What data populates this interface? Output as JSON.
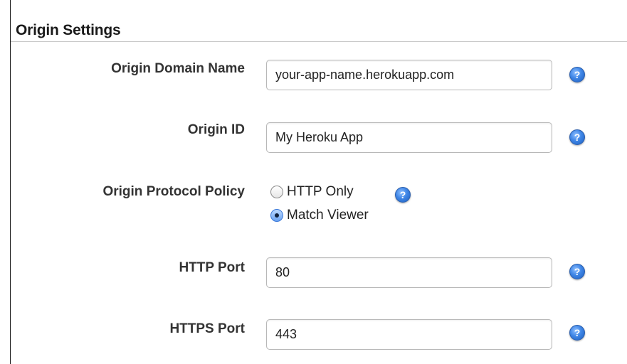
{
  "section": {
    "title": "Origin Settings"
  },
  "fields": {
    "origin_domain_name": {
      "label": "Origin Domain Name",
      "value": "your-app-name.herokuapp.com"
    },
    "origin_id": {
      "label": "Origin ID",
      "value": "My Heroku App"
    },
    "origin_protocol_policy": {
      "label": "Origin Protocol Policy",
      "options": [
        "HTTP Only",
        "Match Viewer"
      ],
      "selected": "Match Viewer"
    },
    "http_port": {
      "label": "HTTP Port",
      "value": "80"
    },
    "https_port": {
      "label": "HTTPS Port",
      "value": "443"
    }
  },
  "help_icon_glyph": "?",
  "colors": {
    "help_icon": "#3f86e6",
    "radio_checked": "#6aa3f2",
    "label_text": "#333333"
  }
}
